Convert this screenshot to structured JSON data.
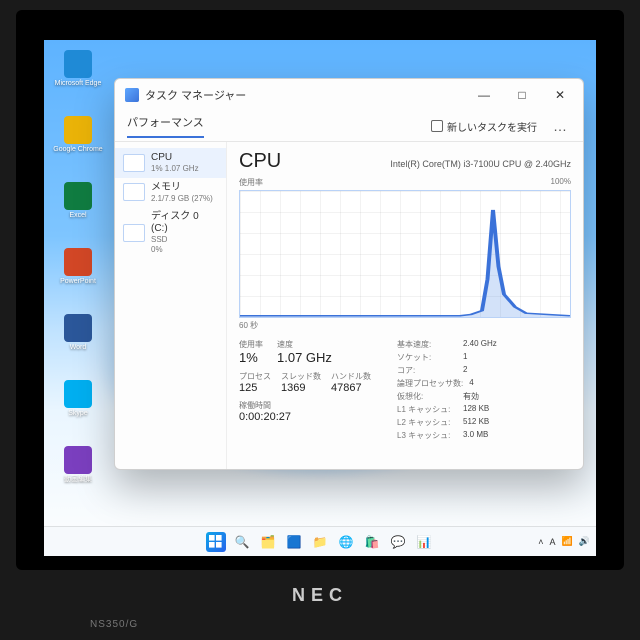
{
  "hardware": {
    "brand": "NEC",
    "model": "NS350/G"
  },
  "desktop": {
    "icons": [
      {
        "label": "Microsoft Edge",
        "color": "#1f8ad6"
      },
      {
        "label": "Google Chrome",
        "color": "#eab308"
      },
      {
        "label": "Excel",
        "color": "#107c41"
      },
      {
        "label": "PowerPoint",
        "color": "#d24726"
      },
      {
        "label": "Word",
        "color": "#2b579a"
      },
      {
        "label": "Skype",
        "color": "#00aff0"
      },
      {
        "label": "動画編集",
        "color": "#7b3fbf"
      }
    ]
  },
  "taskmanager": {
    "title": "タスク マネージャー",
    "tab": "パフォーマンス",
    "run_task": "新しいタスクを実行",
    "more": "…",
    "window": {
      "minimize": "—",
      "maximize": "□",
      "close": "✕"
    },
    "side": [
      {
        "name": "CPU",
        "sub": "1%  1.07 GHz",
        "selected": true
      },
      {
        "name": "メモリ",
        "sub": "2.1/7.9 GB (27%)",
        "selected": false
      },
      {
        "name": "ディスク 0 (C:)",
        "sub": "SSD\n0%",
        "selected": false
      }
    ],
    "main": {
      "title": "CPU",
      "model": "Intel(R) Core(TM) i3-7100U CPU @ 2.40GHz",
      "usage_label": "使用率",
      "y_max": "100%",
      "x_label": "60 秒",
      "usage": {
        "label": "使用率",
        "value": "1%"
      },
      "speed": {
        "label": "速度",
        "value": "1.07 GHz"
      },
      "processes": {
        "label": "プロセス",
        "value": "125"
      },
      "threads": {
        "label": "スレッド数",
        "value": "1369"
      },
      "handles": {
        "label": "ハンドル数",
        "value": "47867"
      },
      "uptime": {
        "label": "稼働時間",
        "value": "0:00:20:27"
      },
      "specs": [
        {
          "k": "基本速度:",
          "v": "2.40 GHz"
        },
        {
          "k": "ソケット:",
          "v": "1"
        },
        {
          "k": "コア:",
          "v": "2"
        },
        {
          "k": "論理プロセッサ数:",
          "v": "4"
        },
        {
          "k": "仮想化:",
          "v": "有効"
        },
        {
          "k": "L1 キャッシュ:",
          "v": "128 KB"
        },
        {
          "k": "L2 キャッシュ:",
          "v": "512 KB"
        },
        {
          "k": "L3 キャッシュ:",
          "v": "3.0 MB"
        }
      ]
    }
  },
  "chart_data": {
    "type": "line",
    "title": "CPU 使用率",
    "xlabel": "秒",
    "ylabel": "%",
    "ylim": [
      0,
      100
    ],
    "xlim": [
      0,
      60
    ],
    "x": [
      0,
      4,
      8,
      12,
      16,
      20,
      24,
      28,
      32,
      36,
      40,
      42,
      44,
      45,
      46,
      47,
      48,
      50,
      52,
      56,
      60
    ],
    "values": [
      1,
      1,
      1,
      1,
      1,
      1,
      1,
      1,
      1,
      1,
      1,
      2,
      5,
      30,
      85,
      40,
      18,
      8,
      3,
      2,
      1
    ]
  },
  "taskbar": {
    "items": [
      "start",
      "search",
      "taskview",
      "widgets",
      "explorer",
      "edge",
      "store",
      "chat",
      "taskmgr",
      "folder"
    ]
  }
}
